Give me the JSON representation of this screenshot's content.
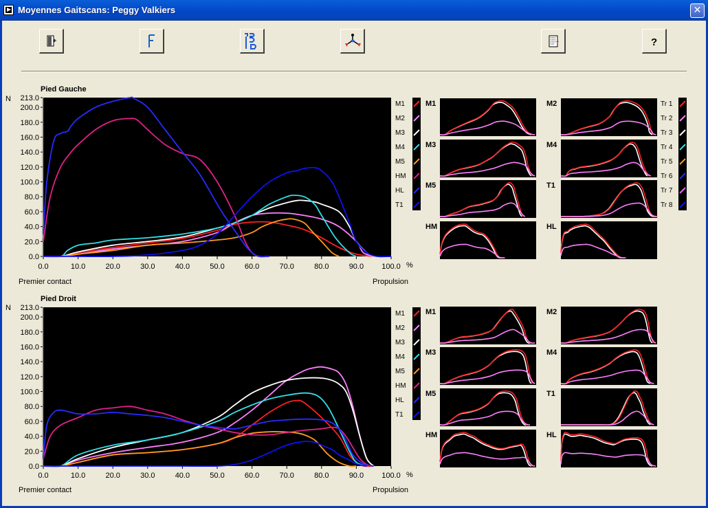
{
  "window": {
    "title": "Moyennes Gaitscans: Peggy Valkiers"
  },
  "toolbar": [
    {
      "name": "exit-icon",
      "glyph": "⇦"
    },
    {
      "name": "f-icon",
      "glyph": "F"
    },
    {
      "name": "foot-switch-icon",
      "glyph": ""
    },
    {
      "name": "graph-tree-icon",
      "glyph": ""
    },
    {
      "name": "print-icon",
      "glyph": ""
    },
    {
      "name": "help-icon",
      "glyph": "?"
    }
  ],
  "panels": {
    "left": {
      "title": "Pied Gauche",
      "unit": "N",
      "x_unit": "%",
      "start_label": "Premier contact",
      "end_label": "Propulsion"
    },
    "right": {
      "title": "Pied Droit",
      "unit": "N",
      "x_unit": "%",
      "start_label": "Premier contact",
      "end_label": "Propulsion"
    }
  },
  "legend_zones": [
    "M1",
    "M2",
    "M3",
    "M4",
    "M5",
    "HM",
    "HL",
    "T1"
  ],
  "legend_trials": [
    "Tr 1",
    "Tr 2",
    "Tr 3",
    "Tr 4",
    "Tr 5",
    "Tr 6",
    "Tr 7",
    "Tr 8"
  ],
  "small_zones": [
    "M1",
    "M2",
    "M3",
    "M4",
    "M5",
    "T1",
    "HM",
    "HL"
  ],
  "colors": {
    "M1": "#ff2020",
    "M2": "#ff80ff",
    "M3": "#ffffff",
    "M4": "#30e0e8",
    "M5": "#ff9a20",
    "HM": "#e0208a",
    "HL": "#2a2aff",
    "T1": "#1010f0",
    "trials": [
      "#ff2020",
      "#ff80ff",
      "#ffffff",
      "#30e0e8",
      "#ff9a20",
      "#2a2aff",
      "#ff60ff",
      "#1010f0"
    ],
    "plot_bg": "#000000"
  },
  "chart_data": [
    {
      "type": "line",
      "title": "Pied Gauche",
      "ylabel": "N",
      "xlabel": "%",
      "xlim": [
        0,
        100
      ],
      "ylim": [
        0,
        213
      ],
      "xticks": [
        "0.0",
        "10.0",
        "20.0",
        "30.0",
        "40.0",
        "50.0",
        "60.0",
        "70.0",
        "80.0",
        "90.0",
        "100.0"
      ],
      "yticks": [
        "0.0",
        "20.0",
        "40.0",
        "60.0",
        "80.0",
        "100.0",
        "120.0",
        "140.0",
        "160.0",
        "180.0",
        "200.0",
        "213.0"
      ],
      "series": [
        {
          "name": "M1",
          "x": [
            0,
            5,
            10,
            20,
            30,
            40,
            50,
            55,
            60,
            65,
            70,
            75,
            80,
            85,
            90,
            95
          ],
          "y": [
            0,
            0,
            5,
            12,
            18,
            24,
            35,
            43,
            46,
            46,
            42,
            36,
            25,
            12,
            3,
            0
          ]
        },
        {
          "name": "M2",
          "x": [
            0,
            5,
            10,
            20,
            30,
            40,
            50,
            55,
            60,
            65,
            70,
            75,
            80,
            85,
            90,
            92,
            95
          ],
          "y": [
            0,
            0,
            3,
            10,
            15,
            20,
            32,
            45,
            55,
            58,
            58,
            55,
            50,
            40,
            20,
            5,
            0
          ]
        },
        {
          "name": "M3",
          "x": [
            0,
            5,
            10,
            20,
            30,
            40,
            50,
            55,
            60,
            65,
            70,
            73,
            75,
            78,
            80,
            85,
            88,
            90,
            93,
            95
          ],
          "y": [
            0,
            0,
            6,
            15,
            20,
            26,
            38,
            45,
            55,
            65,
            72,
            75,
            75,
            73,
            70,
            60,
            40,
            20,
            5,
            0
          ]
        },
        {
          "name": "M4",
          "x": [
            0,
            5,
            7,
            10,
            15,
            20,
            30,
            40,
            50,
            55,
            60,
            65,
            70,
            72,
            75,
            78,
            80,
            84,
            88,
            90
          ],
          "y": [
            0,
            0,
            8,
            15,
            18,
            22,
            25,
            30,
            38,
            45,
            55,
            70,
            80,
            82,
            80,
            70,
            55,
            25,
            5,
            0
          ]
        },
        {
          "name": "M5",
          "x": [
            0,
            5,
            10,
            20,
            30,
            40,
            50,
            55,
            60,
            63,
            67,
            70,
            72,
            75,
            77,
            80,
            83,
            85
          ],
          "y": [
            0,
            0,
            3,
            8,
            15,
            18,
            22,
            25,
            32,
            40,
            47,
            50,
            50,
            45,
            35,
            20,
            5,
            0
          ]
        },
        {
          "name": "HM",
          "x": [
            0,
            2,
            5,
            8,
            10,
            15,
            20,
            25,
            27,
            30,
            35,
            40,
            45,
            50,
            55,
            58,
            60,
            62,
            65
          ],
          "y": [
            20,
            80,
            120,
            140,
            150,
            170,
            182,
            185,
            183,
            170,
            150,
            138,
            130,
            100,
            55,
            20,
            5,
            0,
            0
          ]
        },
        {
          "name": "HL",
          "x": [
            0,
            1,
            3,
            5,
            7,
            8,
            10,
            15,
            20,
            25,
            26,
            30,
            35,
            40,
            45,
            50,
            52,
            55,
            58,
            60,
            62,
            65
          ],
          "y": [
            30,
            100,
            155,
            165,
            168,
            175,
            185,
            200,
            208,
            213,
            212,
            200,
            170,
            140,
            110,
            70,
            55,
            35,
            15,
            5,
            0,
            0
          ]
        },
        {
          "name": "T1",
          "x": [
            0,
            10,
            20,
            30,
            40,
            45,
            50,
            55,
            60,
            65,
            70,
            73,
            75,
            78,
            80,
            83,
            85,
            88,
            90,
            93,
            96,
            100
          ],
          "y": [
            0,
            0,
            0,
            2,
            8,
            15,
            30,
            55,
            80,
            100,
            112,
            115,
            118,
            119,
            115,
            100,
            80,
            45,
            20,
            5,
            0,
            0
          ]
        }
      ]
    },
    {
      "type": "line",
      "title": "Pied Droit",
      "ylabel": "N",
      "xlabel": "%",
      "xlim": [
        0,
        100
      ],
      "ylim": [
        0,
        213
      ],
      "xticks": [
        "0.0",
        "10.0",
        "20.0",
        "30.0",
        "40.0",
        "50.0",
        "60.0",
        "70.0",
        "80.0",
        "90.0",
        "100.0"
      ],
      "yticks": [
        "0.0",
        "20.0",
        "40.0",
        "60.0",
        "80.0",
        "100.0",
        "120.0",
        "140.0",
        "160.0",
        "180.0",
        "200.0",
        "213.0"
      ],
      "series": [
        {
          "name": "M1",
          "x": [
            0,
            5,
            10,
            20,
            30,
            40,
            50,
            55,
            60,
            65,
            70,
            73,
            75,
            80,
            85,
            88,
            90,
            92,
            95
          ],
          "y": [
            0,
            0,
            5,
            15,
            18,
            22,
            30,
            38,
            55,
            72,
            85,
            88,
            85,
            65,
            40,
            15,
            5,
            0,
            0
          ]
        },
        {
          "name": "M2",
          "x": [
            0,
            5,
            10,
            20,
            30,
            40,
            50,
            55,
            60,
            65,
            70,
            75,
            78,
            80,
            83,
            85,
            87,
            89,
            91,
            93,
            95
          ],
          "y": [
            0,
            0,
            8,
            18,
            25,
            32,
            45,
            58,
            75,
            95,
            115,
            128,
            132,
            133,
            130,
            125,
            110,
            80,
            40,
            10,
            0
          ]
        },
        {
          "name": "M3",
          "x": [
            0,
            5,
            10,
            20,
            30,
            40,
            50,
            55,
            60,
            65,
            70,
            75,
            80,
            83,
            85,
            87,
            89,
            91,
            93,
            95
          ],
          "y": [
            0,
            0,
            10,
            25,
            35,
            45,
            65,
            82,
            98,
            108,
            115,
            118,
            118,
            115,
            110,
            100,
            75,
            40,
            10,
            0
          ]
        },
        {
          "name": "M4",
          "x": [
            0,
            5,
            10,
            20,
            30,
            40,
            50,
            55,
            60,
            65,
            70,
            75,
            78,
            80,
            82,
            84,
            86,
            88,
            90,
            93
          ],
          "y": [
            0,
            0,
            15,
            28,
            35,
            45,
            60,
            72,
            82,
            90,
            95,
            98,
            96,
            90,
            78,
            60,
            40,
            20,
            5,
            0
          ]
        },
        {
          "name": "M5",
          "x": [
            0,
            5,
            10,
            20,
            30,
            40,
            50,
            55,
            60,
            65,
            68,
            72,
            75,
            78,
            80,
            82,
            85,
            88,
            90
          ],
          "y": [
            0,
            0,
            5,
            15,
            18,
            22,
            30,
            38,
            44,
            46,
            46,
            45,
            42,
            35,
            25,
            15,
            5,
            0,
            0
          ]
        },
        {
          "name": "HM",
          "x": [
            0,
            2,
            5,
            10,
            15,
            20,
            25,
            30,
            35,
            40,
            45,
            50,
            55,
            60,
            65,
            70,
            75,
            80,
            83,
            85,
            87,
            89,
            91,
            93,
            95
          ],
          "y": [
            10,
            40,
            55,
            65,
            75,
            78,
            80,
            75,
            70,
            62,
            55,
            50,
            45,
            42,
            42,
            45,
            48,
            50,
            52,
            50,
            40,
            25,
            10,
            2,
            0
          ]
        },
        {
          "name": "HL",
          "x": [
            0,
            1,
            3,
            5,
            8,
            10,
            15,
            20,
            25,
            30,
            35,
            40,
            45,
            50,
            55,
            60,
            65,
            70,
            75,
            80,
            83,
            85,
            87,
            89,
            92,
            95
          ],
          "y": [
            10,
            55,
            72,
            75,
            72,
            70,
            70,
            72,
            70,
            68,
            65,
            60,
            55,
            52,
            50,
            55,
            60,
            62,
            63,
            62,
            58,
            50,
            35,
            15,
            3,
            0
          ]
        },
        {
          "name": "T1",
          "x": [
            0,
            10,
            20,
            30,
            40,
            50,
            55,
            60,
            65,
            70,
            75,
            78,
            80,
            83,
            85,
            88,
            90,
            93
          ],
          "y": [
            0,
            0,
            0,
            0,
            0,
            0,
            2,
            8,
            18,
            28,
            33,
            32,
            28,
            22,
            15,
            8,
            3,
            0
          ]
        }
      ]
    }
  ]
}
